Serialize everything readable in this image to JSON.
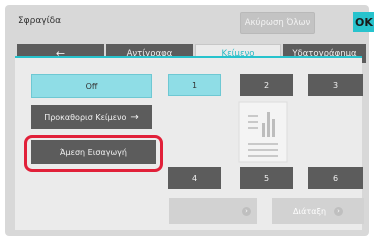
{
  "header": {
    "title": "Σφραγίδα",
    "cancel_all_label": "Ακύρωση Όλων",
    "ok_label": "OK"
  },
  "tabs": [
    {
      "label": "←",
      "icon": "back-arrow-icon"
    },
    {
      "label": "Αντίγραφα"
    },
    {
      "label": "Κείμενο",
      "active": true
    },
    {
      "label": "Υδατογράφημα"
    }
  ],
  "options": {
    "off_label": "Off",
    "preset_text_label": "Προκαθορισ Κείμενο",
    "direct_entry_label": "Άμεση Εισαγωγή"
  },
  "positions": [
    "1",
    "2",
    "3",
    "4",
    "5",
    "6"
  ],
  "selected_position": "1",
  "bottom": {
    "layout_label": "Διάταξη"
  },
  "colors": {
    "accent": "#27c3cd",
    "highlight": "#e12039",
    "dark_button": "#5c5c5c"
  }
}
